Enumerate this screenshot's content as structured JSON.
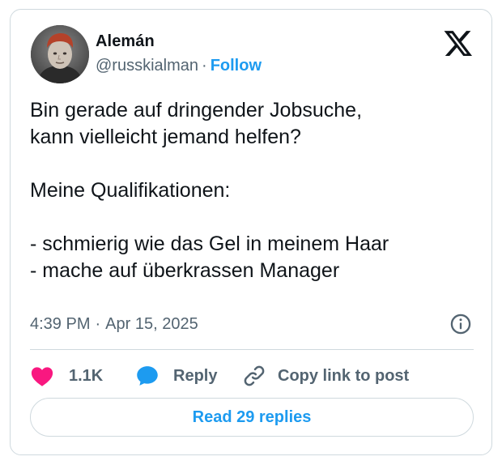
{
  "author": {
    "display_name": "Alemán",
    "handle": "@russkialman",
    "follow_label": "Follow"
  },
  "tweet": {
    "text": "Bin gerade auf dringender Jobsuche,\nkann vielleicht jemand helfen?\n\nMeine Qualifikationen:\n\n- schmierig wie das Gel in meinem Haar\n- mache auf überkrassen Manager",
    "time": "4:39 PM",
    "date": "Apr 15, 2025"
  },
  "actions": {
    "likes_count": "1.1K",
    "reply_label": "Reply",
    "copy_link_label": "Copy link to post"
  },
  "footer": {
    "read_replies_label": "Read 29 replies"
  },
  "icons": {
    "platform_logo": "x-logo-icon",
    "info": "info-icon",
    "like": "heart-icon",
    "reply": "speech-bubble-icon",
    "copy_link": "link-icon"
  },
  "colors": {
    "accent": "#1d9bf0",
    "like": "#f91880",
    "text": "#0f1419",
    "muted": "#536471",
    "border": "#cfd9de"
  }
}
